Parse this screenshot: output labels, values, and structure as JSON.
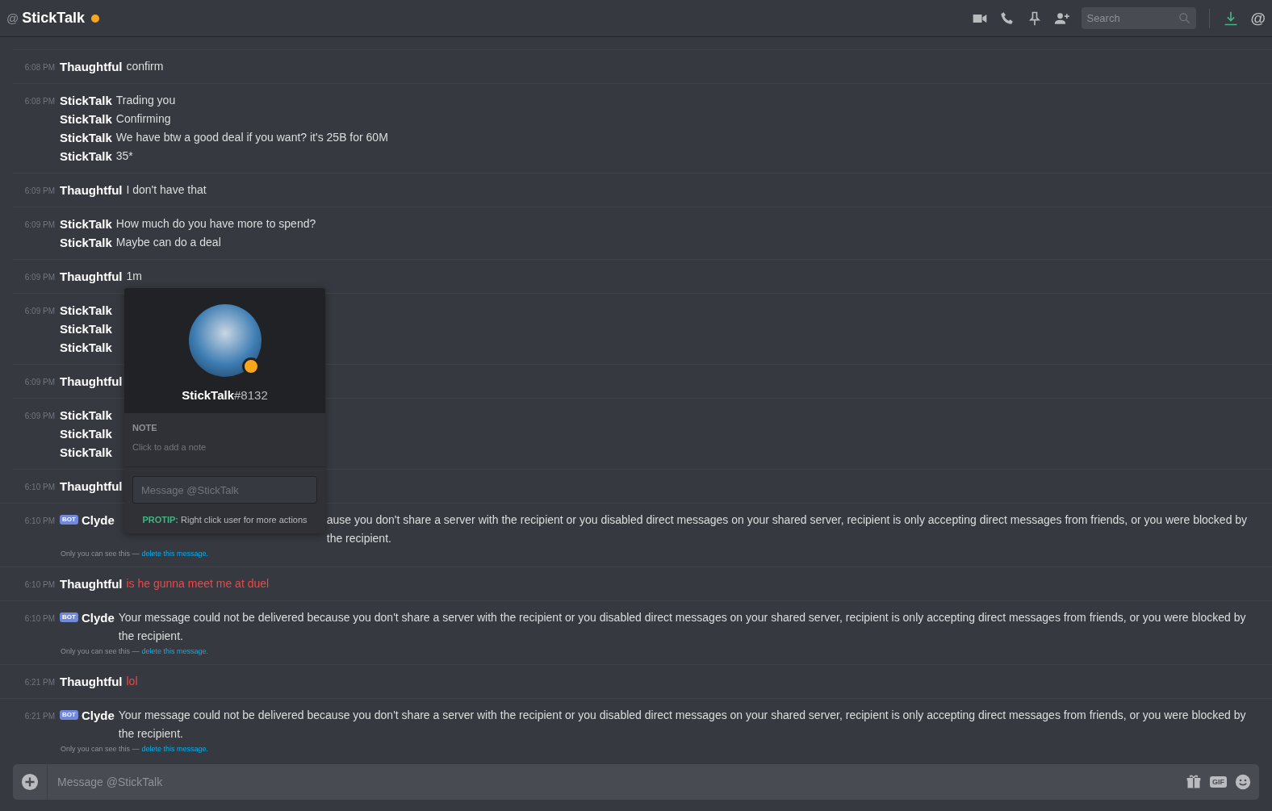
{
  "header": {
    "at_sign": "@",
    "title": "StickTalk",
    "idle": true,
    "search": {
      "placeholder": "Search"
    },
    "mentions_glyph": "@"
  },
  "messages": [
    {
      "time": "6:08 PM",
      "lines": [
        {
          "author": "Thaughtful",
          "text": "confirm"
        }
      ]
    },
    {
      "time": "6:08 PM",
      "lines": [
        {
          "author": "StickTalk",
          "text": "Trading you"
        },
        {
          "author": "StickTalk",
          "text": "Confirming"
        },
        {
          "author": "StickTalk",
          "text": "We have btw a good deal if you want? it's 25B for 60M"
        },
        {
          "author": "StickTalk",
          "text": "35*"
        }
      ]
    },
    {
      "time": "6:09 PM",
      "lines": [
        {
          "author": "Thaughtful",
          "text": "I don't have that"
        }
      ]
    },
    {
      "time": "6:09 PM",
      "lines": [
        {
          "author": "StickTalk",
          "text": "How much do you have more to spend?"
        },
        {
          "author": "StickTalk",
          "text": "Maybe can do a deal"
        }
      ]
    },
    {
      "time": "6:09 PM",
      "lines": [
        {
          "author": "Thaughtful",
          "text": "1m"
        }
      ]
    },
    {
      "time": "6:09 PM",
      "lines": [
        {
          "author": "StickTalk"
        },
        {
          "author": "StickTalk"
        },
        {
          "author": "StickTalk"
        }
      ]
    },
    {
      "time": "6:09 PM",
      "lines": [
        {
          "author": "Thaughtful"
        }
      ]
    },
    {
      "time": "6:09 PM",
      "lines": [
        {
          "author": "StickTalk"
        },
        {
          "author": "StickTalk"
        },
        {
          "author": "StickTalk"
        }
      ]
    },
    {
      "time": "6:10 PM",
      "lines": [
        {
          "author": "Thaughtful"
        }
      ]
    },
    {
      "time": "6:10 PM",
      "lines": [
        {
          "author": "Clyde",
          "bot_badge": "BOT",
          "covered": true,
          "text": "ause you don't share a server with the recipient or you disabled direct messages on your shared server, recipient is only accepting direct messages from friends, or you were blocked by the recipient."
        }
      ],
      "ephemeral": {
        "note": "Only you can see this —",
        "link": "delete this message."
      }
    },
    {
      "time": "6:10 PM",
      "lines": [
        {
          "author": "Thaughtful",
          "text": "is he gunna meet me at duel",
          "failed": true
        }
      ]
    },
    {
      "time": "6:10 PM",
      "lines": [
        {
          "author": "Clyde",
          "bot_badge": "BOT",
          "text": "Your message could not be delivered because you don't share a server with the recipient or you disabled direct messages on your shared server, recipient is only accepting direct messages from friends, or you were blocked by the recipient."
        }
      ],
      "ephemeral": {
        "note": "Only you can see this —",
        "link": "delete this message."
      }
    },
    {
      "time": "6:21 PM",
      "lines": [
        {
          "author": "Thaughtful",
          "text": "lol",
          "failed": true
        }
      ]
    },
    {
      "time": "6:21 PM",
      "lines": [
        {
          "author": "Clyde",
          "bot_badge": "BOT",
          "text": "Your message could not be delivered because you don't share a server with the recipient or you disabled direct messages on your shared server, recipient is only accepting direct messages from friends, or you were blocked by the recipient."
        }
      ],
      "ephemeral": {
        "note": "Only you can see this —",
        "link": "delete this message."
      }
    }
  ],
  "profile_popup": {
    "username": "StickTalk",
    "discriminator": "#8132",
    "idle": true,
    "note_label": "NOTE",
    "note_placeholder": "Click to add a note",
    "message_placeholder": "Message @StickTalk",
    "protip_label": "PROTIP:",
    "protip_text": "Right click user for more actions"
  },
  "composer": {
    "placeholder": "Message @StickTalk",
    "gif_label": "GIF"
  }
}
